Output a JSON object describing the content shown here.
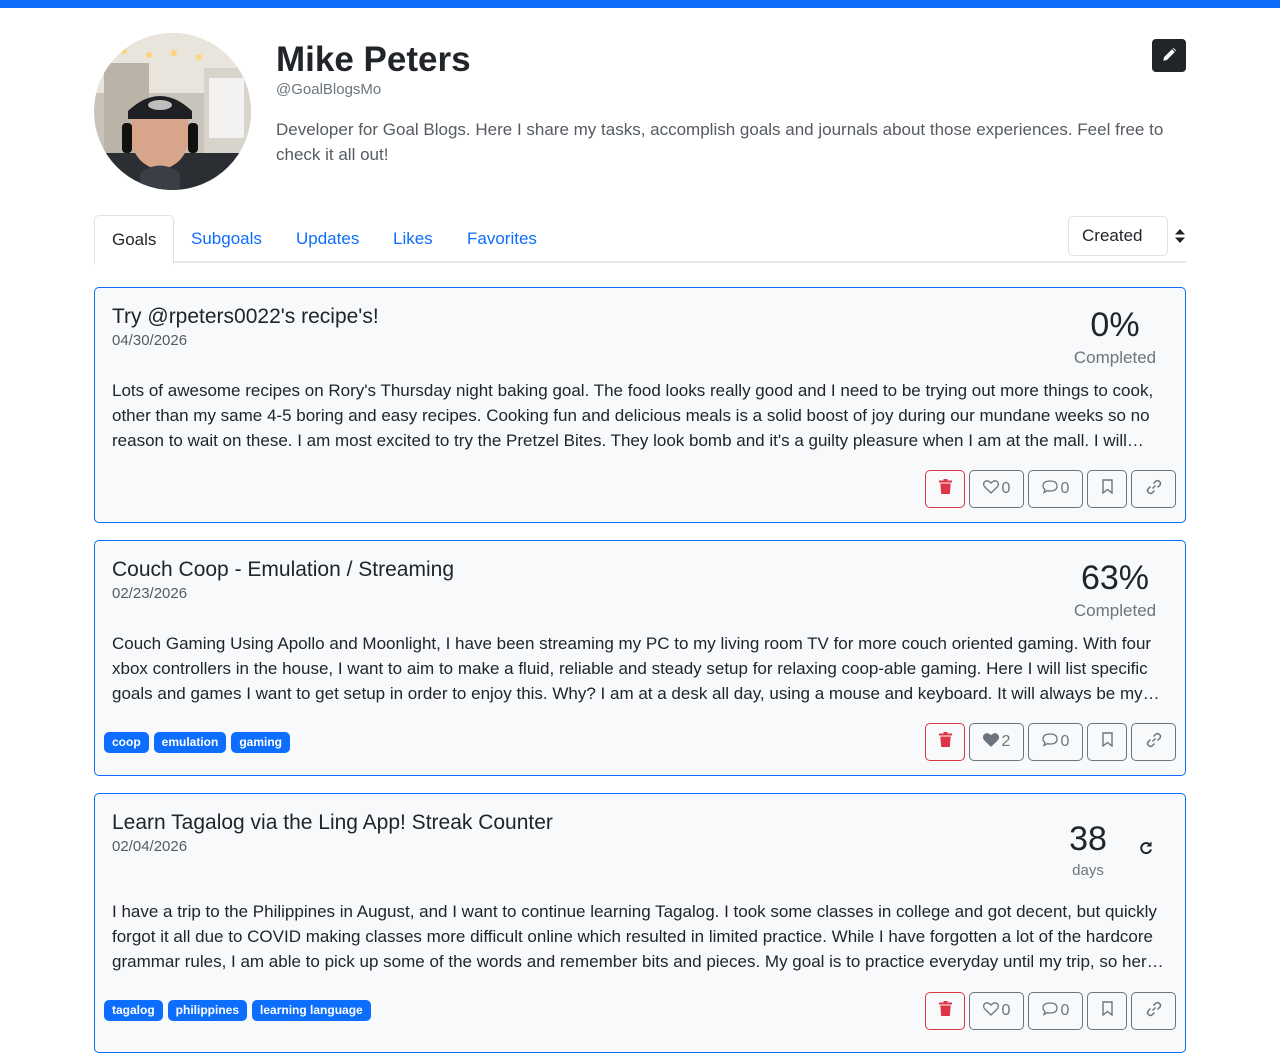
{
  "profile": {
    "name": "Mike Peters",
    "handle": "@GoalBlogsMo",
    "bio": "Developer for Goal Blogs. Here I share my tasks, accomplish goals and journals about those experiences. Feel free to check it all out!"
  },
  "tabs": [
    {
      "label": "Goals",
      "active": true
    },
    {
      "label": "Subgoals",
      "active": false
    },
    {
      "label": "Updates",
      "active": false
    },
    {
      "label": "Likes",
      "active": false
    },
    {
      "label": "Favorites",
      "active": false
    }
  ],
  "sort": {
    "selected": "Created"
  },
  "goals": [
    {
      "title": "Try @rpeters0022's recipe's!",
      "date": "04/30/2026",
      "progress_value": "0%",
      "progress_label": "Completed",
      "description": "Lots of awesome recipes on Rory's Thursday night baking goal. The food looks really good and I need to be trying out more things to cook, other than my same 4-5 boring and easy recipes. Cooking fun and delicious meals is a solid boost of joy during our mundane weeks so no reason to wait on these. I am most excited to try the Pretzel Bites. They look bomb and it's a guilty pleasure when I am at the mall. I will still...",
      "tags": [],
      "likes": "0",
      "liked": false,
      "comments": "0"
    },
    {
      "title": "Couch Coop - Emulation / Streaming",
      "date": "02/23/2026",
      "progress_value": "63%",
      "progress_label": "Completed",
      "description": "Couch Gaming Using Apollo and Moonlight, I have been streaming my PC to my living room TV for more couch oriented gaming. With four xbox controllers in the house, I want to aim to make a fluid, reliable and steady setup for relaxing coop-able gaming. Here I will list specific goals and games I want to get setup in order to enjoy this. Why? I am at a desk all day, using a mouse and keyboard. It will always be my main...",
      "tags": [
        "coop",
        "emulation",
        "gaming"
      ],
      "likes": "2",
      "liked": true,
      "comments": "0"
    },
    {
      "title": "Learn Tagalog via the Ling App! Streak Counter",
      "date": "02/04/2026",
      "progress_value": "38",
      "progress_label": "days",
      "description": "I have a trip to the Philippines in August, and I want to continue learning Tagalog. I took some classes in college and got decent, but quickly forgot it all due to COVID making classes more difficult online which resulted in limited practice. While I have forgotten a lot of the hardcore grammar rules, I am able to pick up some of the words and remember bits and pieces. My goal is to practice everyday until my trip, so here I...",
      "tags": [
        "tagalog",
        "philippines",
        "learning language"
      ],
      "likes": "0",
      "liked": false,
      "comments": "0"
    }
  ],
  "colors": {
    "accent": "#0d6efd",
    "danger": "#dc3545",
    "muted": "#6c757d",
    "card_bg": "#f8f9fa",
    "dark": "#212529"
  },
  "icons": [
    "pencil-icon",
    "sort-arrows-icon",
    "trash-icon",
    "heart-icon",
    "comment-icon",
    "bookmark-icon",
    "link-icon",
    "refresh-icon"
  ]
}
